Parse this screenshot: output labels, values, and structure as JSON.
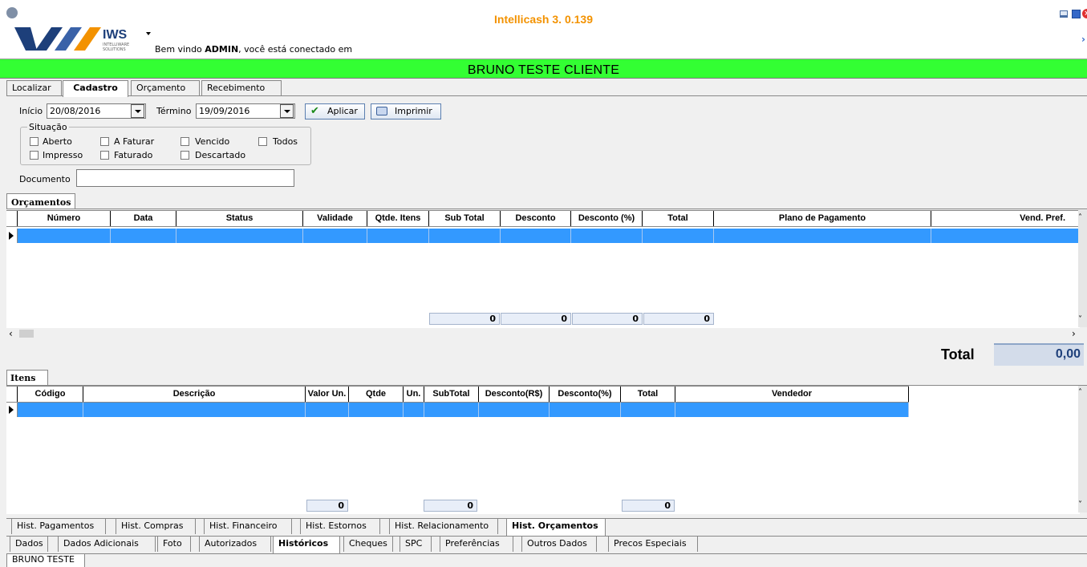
{
  "window": {
    "title": "Intellicash 3. 0.139"
  },
  "brand": {
    "logo_text": "IWS",
    "sub_text": "INTELLIWARE SOLUTIONS"
  },
  "welcome": {
    "prefix": "Bem vindo ",
    "user": "ADMIN",
    "suffix": ", você está conectado em"
  },
  "client_bar": {
    "name": "BRUNO TESTE CLIENTE",
    "color": "#33ff33"
  },
  "main_tabs": [
    {
      "label": "Localizar"
    },
    {
      "label": "Cadastro",
      "active": true
    },
    {
      "label": "Orçamento"
    },
    {
      "label": "Recebimento"
    }
  ],
  "filters": {
    "inicio_label": "Início",
    "inicio_value": "20/08/2016",
    "termino_label": "Término",
    "termino_value": "19/09/2016",
    "apply_label": "Aplicar",
    "print_label": "Imprimir",
    "situacao_label": "Situação",
    "checkboxes": [
      "Aberto",
      "A Faturar",
      "Vencido",
      "Todos",
      "Impresso",
      "Faturado",
      "Descartado"
    ],
    "documento_label": "Documento",
    "documento_value": ""
  },
  "orcamentos": {
    "tab_label": "Orçamentos",
    "columns": [
      "Número",
      "Data",
      "Status",
      "Validade",
      "Qtde. Itens",
      "Sub Total",
      "Desconto",
      "Desconto (%)",
      "Total",
      "Plano de Pagamento",
      "Vend. Pref."
    ],
    "totals": [
      "0",
      "0",
      "0",
      "0"
    ]
  },
  "summary": {
    "total_label": "Total",
    "total_value": "0,00"
  },
  "itens": {
    "tab_label": "Itens",
    "columns": [
      "Código",
      "Descrição",
      "Valor Un.",
      "Qtde",
      "Un.",
      "SubTotal",
      "Desconto(R$)",
      "Desconto(%)",
      "Total",
      "Vendedor"
    ],
    "totals": [
      "0",
      "0",
      "0"
    ]
  },
  "hist_tabs": [
    {
      "label": "Hist. Pagamentos"
    },
    {
      "label": "Hist. Compras"
    },
    {
      "label": "Hist. Financeiro"
    },
    {
      "label": "Hist. Estornos"
    },
    {
      "label": "Hist. Relacionamento"
    },
    {
      "label": "Hist. Orçamentos",
      "active": true
    }
  ],
  "data_tabs": [
    {
      "label": "Dados"
    },
    {
      "label": "Dados Adicionais"
    },
    {
      "label": "Foto"
    },
    {
      "label": "Autorizados"
    },
    {
      "label": "Históricos",
      "active": true
    },
    {
      "label": "Cheques"
    },
    {
      "label": "SPC"
    },
    {
      "label": "Preferências"
    },
    {
      "label": "Outros Dados"
    },
    {
      "label": "Precos Especiais"
    }
  ],
  "client_tab": {
    "label": "BRUNO TESTE"
  }
}
